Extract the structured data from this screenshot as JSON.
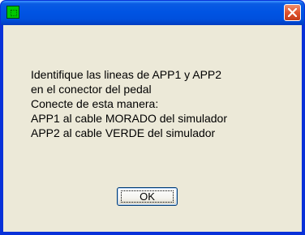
{
  "dialog": {
    "title": "",
    "message_lines": [
      "Identifique las lineas de APP1 y APP2",
      "en el conector del pedal",
      "Conecte de esta manera:",
      "APP1 al cable MORADO del simulador",
      "APP2 al cable VERDE del simulador"
    ],
    "ok_label": "OK"
  },
  "icons": {
    "app": "app-icon",
    "close": "close-icon"
  },
  "colors": {
    "titlebar": "#0054e3",
    "client_background": "#ece9d8",
    "close_button": "#e0532e",
    "app_icon": "#00c800"
  }
}
